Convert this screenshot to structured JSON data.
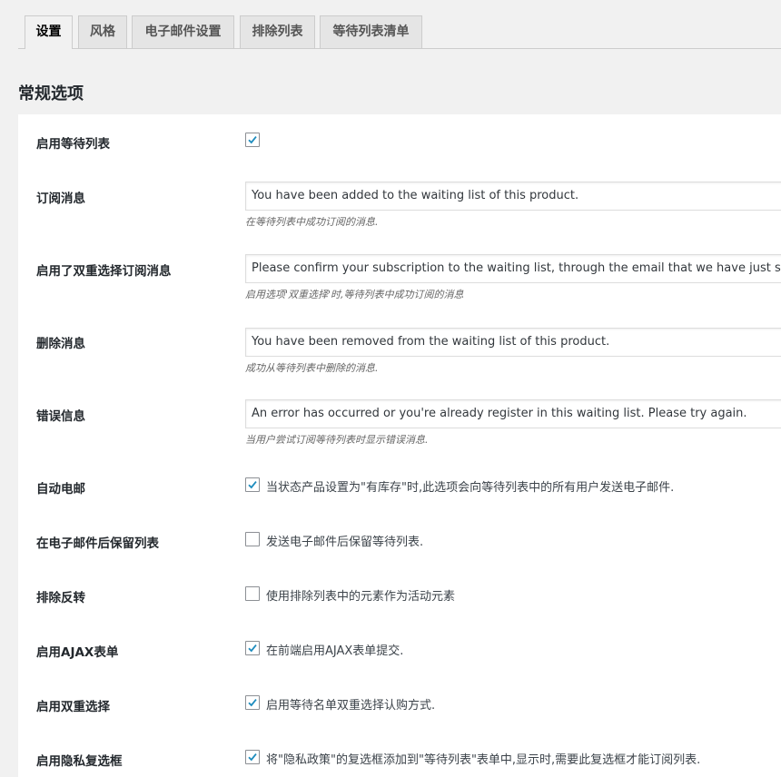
{
  "tabs": [
    {
      "label": "设置",
      "active": true
    },
    {
      "label": "风格",
      "active": false
    },
    {
      "label": "电子邮件设置",
      "active": false
    },
    {
      "label": "排除列表",
      "active": false
    },
    {
      "label": "等待列表清单",
      "active": false
    }
  ],
  "section_title": "常规选项",
  "settings": {
    "enable_waitlist": {
      "label": "启用等待列表",
      "checked": true
    },
    "subscribe_message": {
      "label": "订阅消息",
      "value": "You have been added to the waiting list of this product.",
      "description": "在等待列表中成功订阅的消息."
    },
    "double_optin_message": {
      "label": "启用了双重选择订阅消息",
      "value": "Please confirm your subscription to the waiting list, through the email that we have just sent yo",
      "description": "启用选项'双重选择'时,等待列表中成功订阅的消息"
    },
    "remove_message": {
      "label": "删除消息",
      "value": "You have been removed from the waiting list of this product.",
      "description": "成功从等待列表中删除的消息."
    },
    "error_message": {
      "label": "错误信息",
      "value": "An error has occurred or you're already register in this waiting list. Please try again.",
      "description": "当用户尝试订阅等待列表时显示错误消息."
    },
    "auto_mail": {
      "label": "自动电邮",
      "checked": true,
      "text": "当状态产品设置为\"有库存\"时,此选项会向等待列表中的所有用户发送电子邮件."
    },
    "keep_list": {
      "label": "在电子邮件后保留列表",
      "checked": false,
      "text": "发送电子邮件后保留等待列表."
    },
    "exclusion_inverse": {
      "label": "排除反转",
      "checked": false,
      "text": "使用排除列表中的元素作为活动元素"
    },
    "ajax_form": {
      "label": "启用AJAX表单",
      "checked": true,
      "text": "在前端启用AJAX表单提交."
    },
    "double_optin": {
      "label": "启用双重选择",
      "checked": true,
      "text": "启用等待名单双重选择认购方式."
    },
    "privacy_checkbox": {
      "label": "启用隐私复选框",
      "checked": true,
      "text": "将\"隐私政策\"的复选框添加到\"等待列表\"表单中,显示时,需要此复选框才能订阅列表."
    }
  },
  "colors": {
    "checkmark": "#1e8cbe",
    "page_bg": "#f1f1f1",
    "panel_bg": "#ffffff"
  }
}
